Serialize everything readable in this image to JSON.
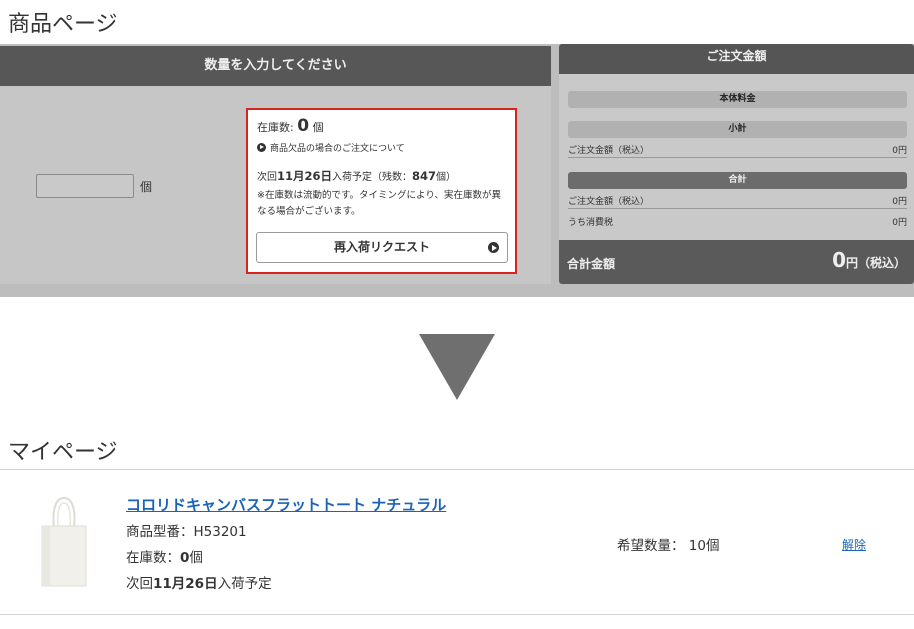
{
  "product_page": {
    "title": "商品ページ",
    "left_header": "数量を入力してください",
    "qty_unit": "個",
    "stock_box": {
      "stock_label": "在庫数:",
      "stock_count": "0",
      "stock_unit": "個",
      "backorder_link": "商品欠品の場合のご注文について",
      "next_prefix": "次回",
      "next_date": "11月26日",
      "next_middle": "入荷予定（残数：",
      "next_remaining": "847",
      "next_suffix": "個）",
      "note": "※在庫数は流動的です。タイミングにより、実在庫数が異なる場合がございます。",
      "restock_button": "再入荷リクエスト"
    },
    "order_panel": {
      "header": "ご注文金額",
      "base_price": "本体料金",
      "subtotal": "小計",
      "subtotal_row_label": "ご注文金額（税込）",
      "subtotal_row_value": "0円",
      "total": "合計",
      "total_row_label": "ご注文金額（税込）",
      "total_row_value": "0円",
      "tax_row_label": "うち消費税",
      "tax_row_value": "0円",
      "grand_total_label": "合計金額",
      "grand_total_number": "0",
      "grand_total_suffix": "円（税込）"
    }
  },
  "mypage": {
    "title": "マイページ",
    "product_name": "コロリドキャンバスフラットトート ナチュラル",
    "model": "商品型番：H53201",
    "stock_prefix": "在庫数：",
    "stock_value": "0",
    "stock_suffix": "個",
    "next_prefix": "次回",
    "next_date": "11月26日",
    "next_suffix": "入荷予定",
    "wish_qty": "希望数量： 10個",
    "cancel": "解除"
  },
  "icons": [
    "circle-arrow-icon",
    "tote-bag-image"
  ]
}
